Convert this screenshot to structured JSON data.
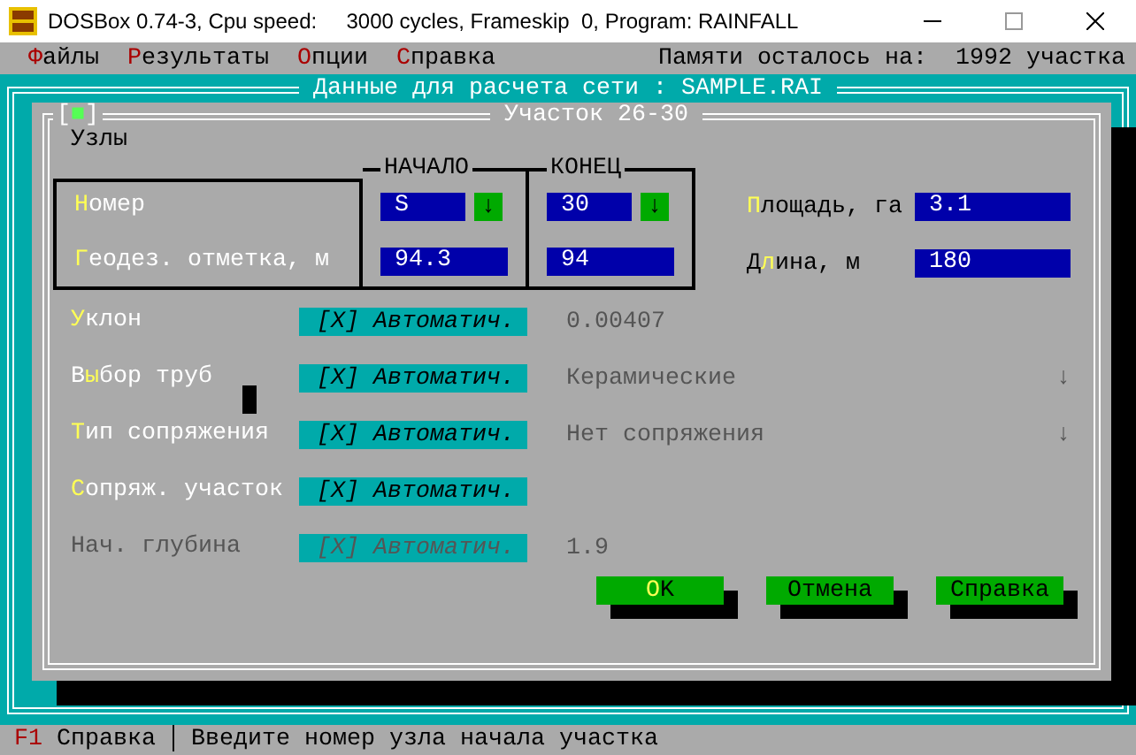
{
  "window": {
    "title": "DOSBox 0.74-3, Cpu speed:     3000 cycles, Frameskip  0, Program: RAINFALL"
  },
  "menu": [
    {
      "key": "Ф",
      "post": "айлы"
    },
    {
      "key": "Р",
      "post": "езультаты"
    },
    {
      "key": "О",
      "post": "пции"
    },
    {
      "key": "С",
      "post": "правка"
    }
  ],
  "memory": "Памяти осталось на:  1992 участка",
  "main_window": {
    "title": "Данные для расчета сети : SAMPLE.RAI"
  },
  "dialog": {
    "close_box": {
      "pre": "[",
      "mark": "■",
      "post": "]"
    },
    "title": "Участок 26-30",
    "nodes": {
      "title": "Узлы",
      "number_label": {
        "key": "Н",
        "post": "омер"
      },
      "elevation_label": {
        "key": "Г",
        "post": "еодез. отметка, м"
      },
      "start": {
        "title": "НАЧАЛО",
        "number": "S",
        "arrow": "↓",
        "elevation": "94.3"
      },
      "end": {
        "title": "КОНЕЦ",
        "number": "30",
        "arrow": "↓",
        "elevation": "94"
      }
    },
    "area": {
      "label": {
        "key": "П",
        "post": "лощадь, га"
      },
      "value": "3.1"
    },
    "length": {
      "label": {
        "pre": "Д",
        "key": "л",
        "post": "ина, м"
      },
      "value": "180"
    },
    "options": [
      {
        "kind": "value",
        "disabled": false,
        "label": {
          "key": "У",
          "post": "клон"
        },
        "checkbox": {
          "open": "[",
          "tick": "X",
          "close": "]",
          "text": "Автоматич.",
          "checked": true
        },
        "value": "0.00407"
      },
      {
        "kind": "dropdown",
        "disabled": false,
        "label": {
          "pre": "В",
          "key": "ы",
          "post": "бор труб"
        },
        "checkbox": {
          "open": "[",
          "tick": "X",
          "close": "]",
          "text": "Автоматич.",
          "checked": true
        },
        "value": "Керамические",
        "arrow": "↓"
      },
      {
        "kind": "dropdown",
        "disabled": false,
        "label": {
          "key": "Т",
          "post": "ип сопряжения"
        },
        "checkbox": {
          "open": "[",
          "tick": "X",
          "close": "]",
          "text": "Автоматич.",
          "checked": true
        },
        "value": "Нет сопряжения",
        "arrow": "↓"
      },
      {
        "kind": "none",
        "disabled": false,
        "label": {
          "key": "С",
          "post": "опряж. участок"
        },
        "checkbox": {
          "open": "[",
          "tick": "X",
          "close": "]",
          "text": "Автоматич.",
          "checked": true
        }
      },
      {
        "kind": "value",
        "disabled": true,
        "label": {
          "text": "Нач. глубина"
        },
        "checkbox": {
          "open": "[",
          "tick": "X",
          "close": "]",
          "text": "Автоматич.",
          "checked": true
        },
        "value": "1.9"
      }
    ],
    "buttons": [
      {
        "key": "O",
        "post": "K"
      },
      {
        "text": "Отмена"
      },
      {
        "text": "Справка"
      }
    ]
  },
  "status_bar": {
    "key": "F1",
    "help": "Справка",
    "separator": "│",
    "message": "Введите номер узла начала участка"
  }
}
